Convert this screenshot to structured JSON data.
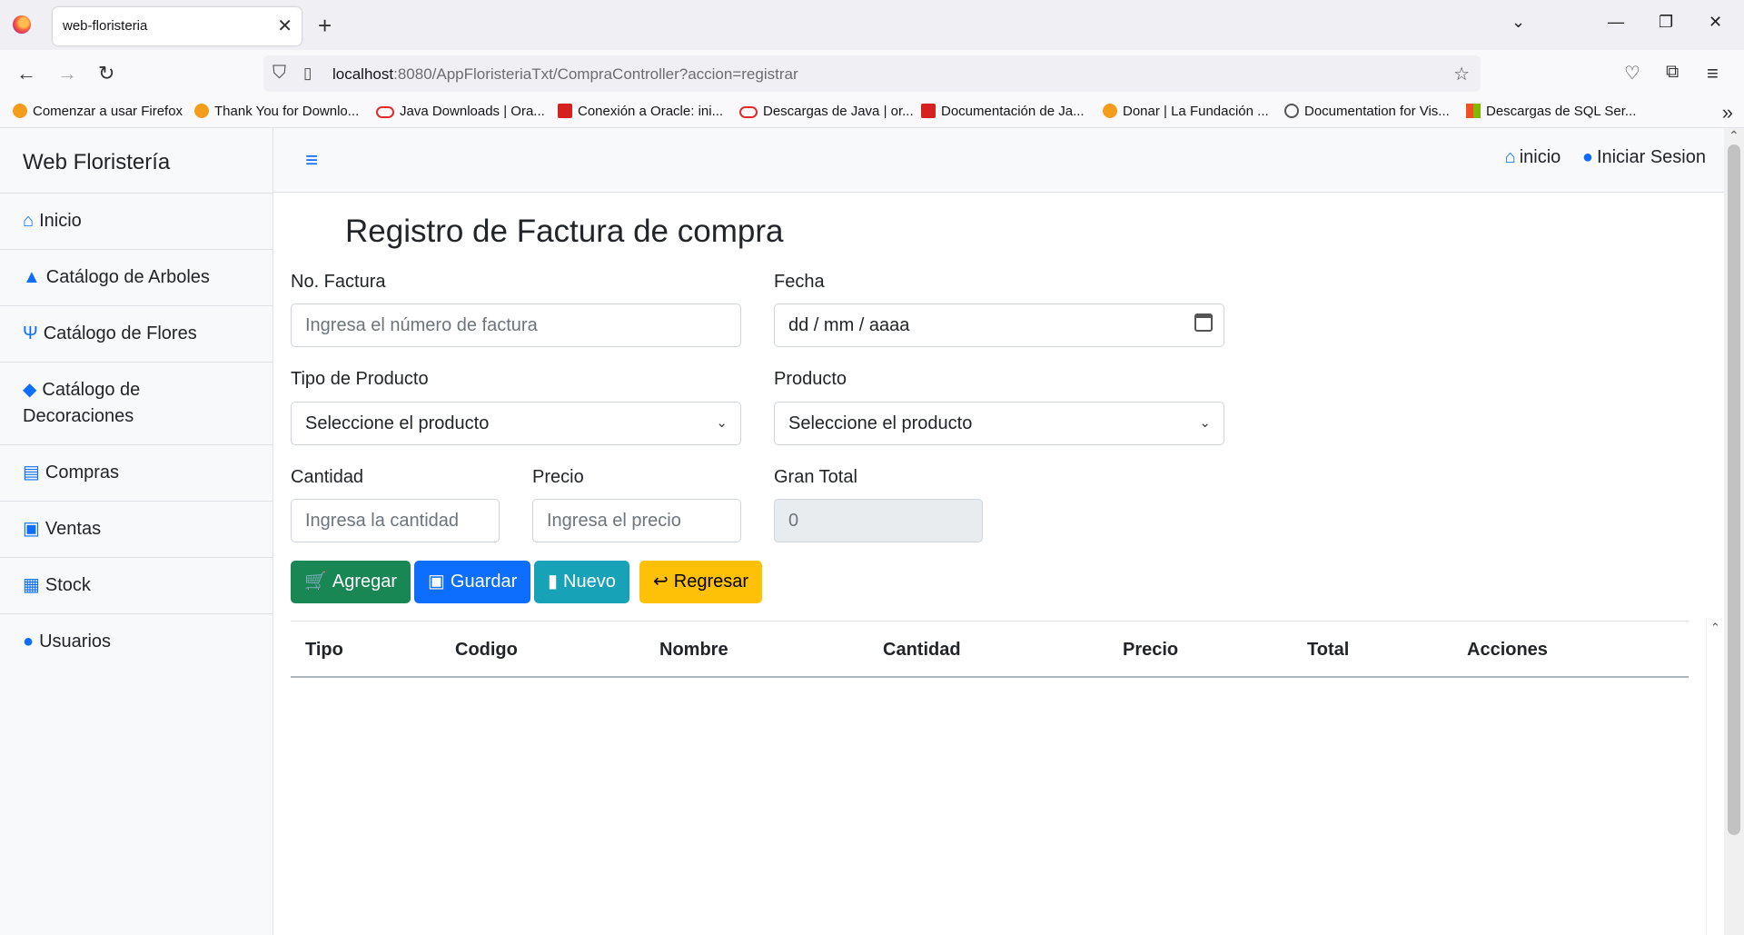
{
  "browser": {
    "tab_title": "web-floristeria",
    "url_host": "localhost",
    "url_rest": ":8080/AppFloristeriaTxt/CompraController?accion=registrar",
    "bookmarks": [
      {
        "label": "Comenzar a usar Firefox",
        "icon": "firefox-icon"
      },
      {
        "label": "Thank You for Downlo...",
        "icon": "ef-icon"
      },
      {
        "label": "Java Downloads | Ora...",
        "icon": "oracle-icon"
      },
      {
        "label": "Conexión a Oracle: ini...",
        "icon": "redsquare-icon"
      },
      {
        "label": "Descargas de Java | or...",
        "icon": "oracle-icon"
      },
      {
        "label": "Documentación de Ja...",
        "icon": "redsquare-icon"
      },
      {
        "label": "Donar | La Fundación ...",
        "icon": "ef-icon"
      },
      {
        "label": "Documentation for Vis...",
        "icon": "globe-icon"
      },
      {
        "label": "Descargas de SQL Ser...",
        "icon": "microsoft-icon"
      }
    ]
  },
  "sidebar": {
    "brand": "Web Floristería",
    "items": [
      {
        "label": "Inicio",
        "icon": "home-icon"
      },
      {
        "label": "Catálogo de Arboles",
        "icon": "tree-icon"
      },
      {
        "label": "Catálogo de Flores",
        "icon": "seedling-icon"
      },
      {
        "label": "Catálogo de Decoraciones",
        "icon": "gem-icon"
      },
      {
        "label": "Compras",
        "icon": "store-icon"
      },
      {
        "label": "Ventas",
        "icon": "cash-icon"
      },
      {
        "label": "Stock",
        "icon": "boxes-icon"
      },
      {
        "label": "Usuarios",
        "icon": "user-icon"
      }
    ]
  },
  "topnav": {
    "home": "inicio",
    "login": "Iniciar Sesion"
  },
  "form": {
    "title": "Registro de Factura de compra",
    "factura_label": "No. Factura",
    "factura_placeholder": "Ingresa el número de factura",
    "fecha_label": "Fecha",
    "fecha_placeholder": "dd / mm / aaaa",
    "tipo_label": "Tipo de Producto",
    "tipo_selected": "Seleccione el producto",
    "producto_label": "Producto",
    "producto_selected": "Seleccione el producto",
    "cantidad_label": "Cantidad",
    "cantidad_placeholder": "Ingresa la cantidad",
    "precio_label": "Precio",
    "precio_placeholder": "Ingresa el precio",
    "total_label": "Gran Total",
    "total_value": "0"
  },
  "buttons": {
    "agregar": "Agregar",
    "guardar": "Guardar",
    "nuevo": "Nuevo",
    "regresar": "Regresar"
  },
  "table": {
    "headers": [
      "Tipo",
      "Codigo",
      "Nombre",
      "Cantidad",
      "Precio",
      "Total",
      "Acciones"
    ]
  }
}
